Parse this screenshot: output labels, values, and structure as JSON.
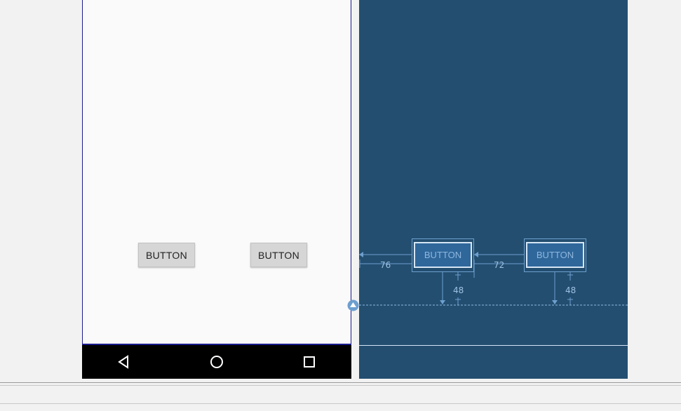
{
  "design": {
    "button1_label": "BUTTON",
    "button2_label": "BUTTON"
  },
  "navbar": {
    "back_icon": "back-triangle-icon",
    "home_icon": "home-circle-icon",
    "recents_icon": "recents-square-icon"
  },
  "blueprint": {
    "button1_label": "BUTTON",
    "button2_label": "BUTTON",
    "margin_left_1": "76",
    "margin_between": "72",
    "margin_bottom_1": "48",
    "margin_bottom_2": "48"
  },
  "colors": {
    "blueprint_bg": "#234e70",
    "constraint": "#6d9fcf",
    "surface_border": "#1a1a8c"
  }
}
